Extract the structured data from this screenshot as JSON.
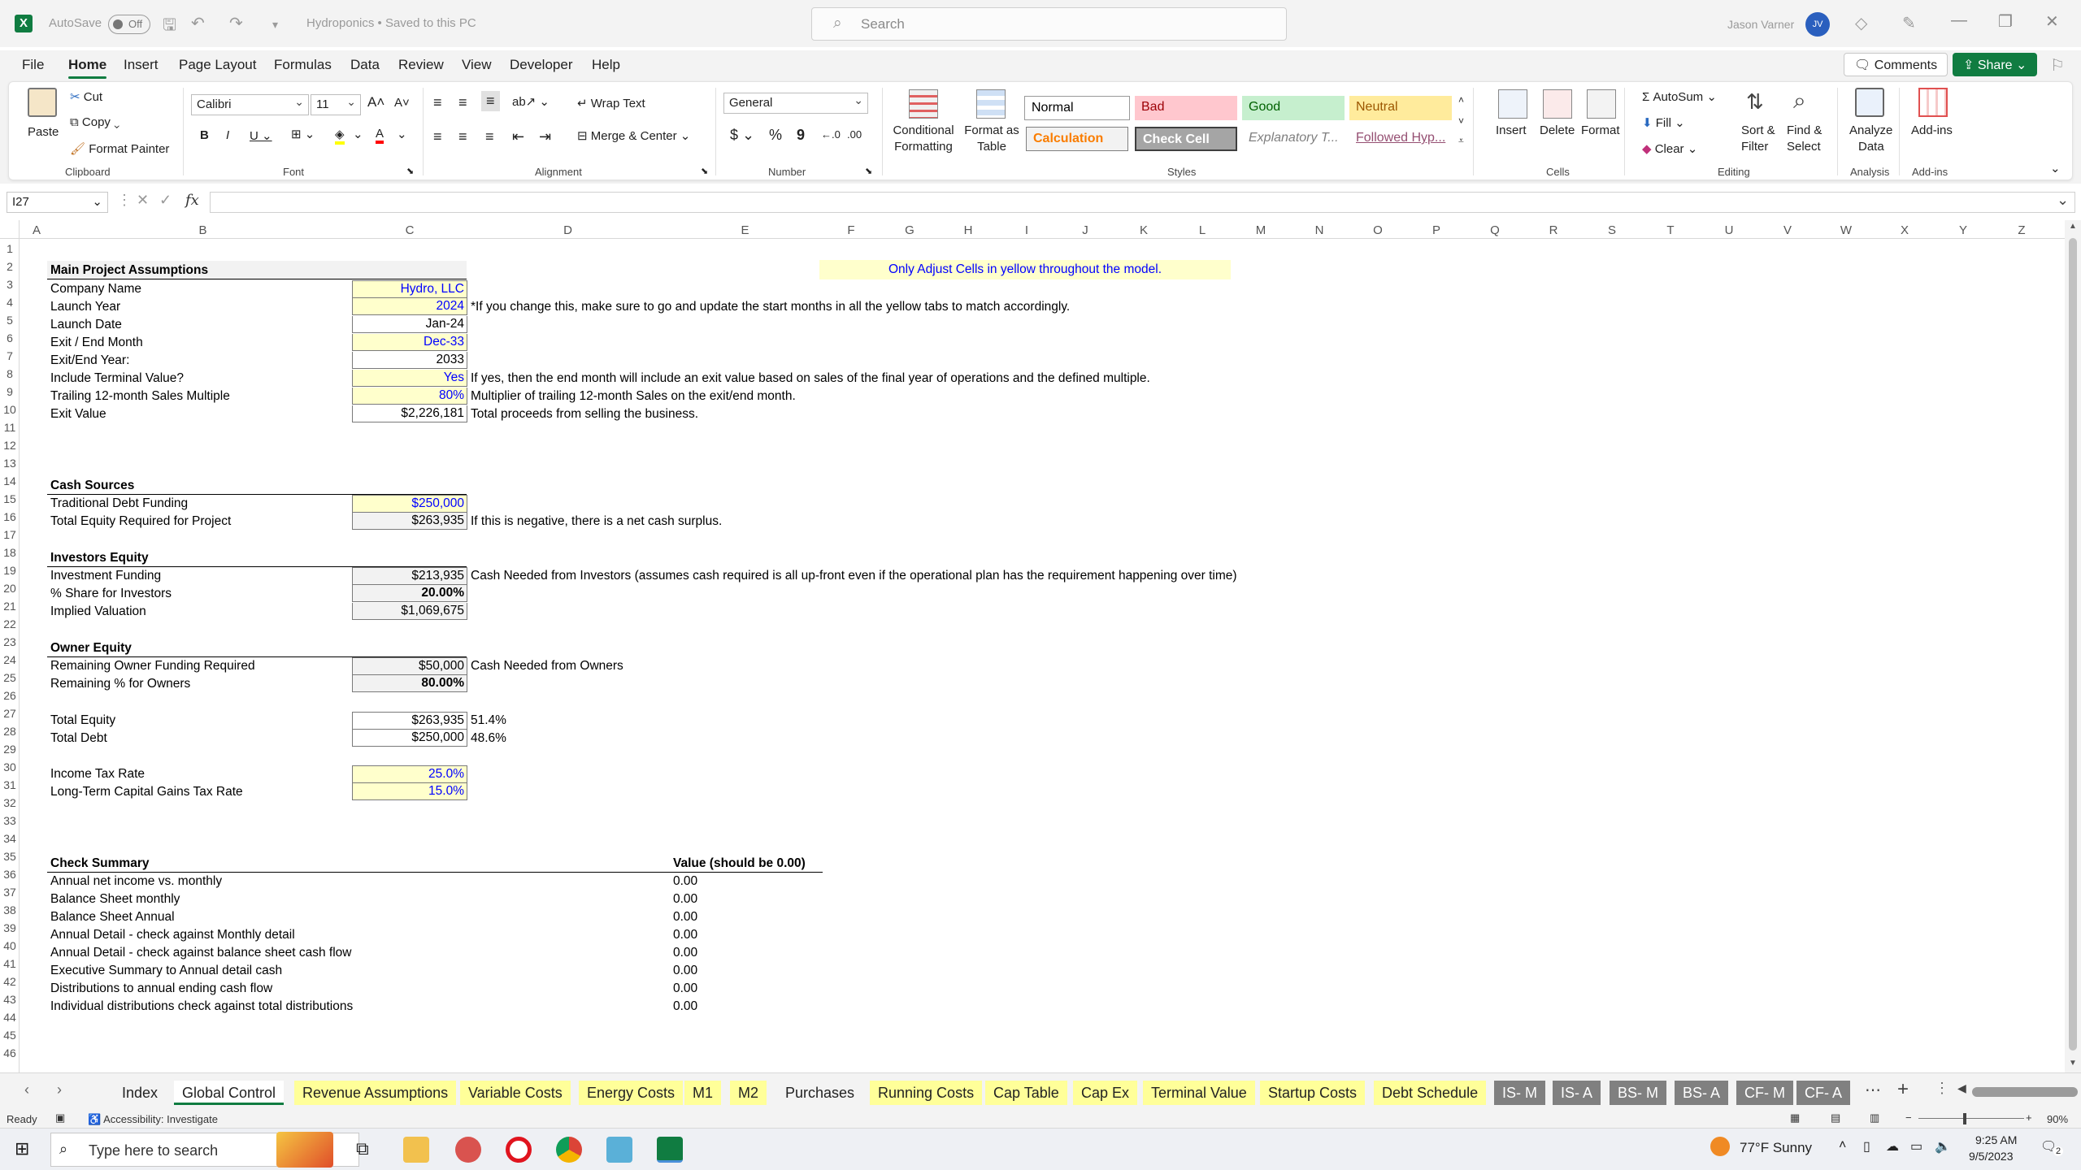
{
  "titlebar": {
    "autosave_label": "AutoSave",
    "autosave_state": "Off",
    "doc_title": "Hydroponics • Saved to this PC",
    "search_placeholder": "Search",
    "user_name": "Jason Varner",
    "user_initials": "JV"
  },
  "menu": {
    "tabs": [
      "File",
      "Home",
      "Insert",
      "Page Layout",
      "Formulas",
      "Data",
      "Review",
      "View",
      "Developer",
      "Help"
    ],
    "comments": "Comments",
    "share": "Share"
  },
  "ribbon": {
    "clipboard": {
      "paste": "Paste",
      "cut": "Cut",
      "copy": "Copy",
      "format_painter": "Format Painter",
      "group": "Clipboard"
    },
    "font": {
      "name": "Calibri",
      "size": "11",
      "group": "Font"
    },
    "alignment": {
      "wrap": "Wrap Text",
      "merge": "Merge & Center",
      "group": "Alignment"
    },
    "number": {
      "format": "General",
      "group": "Number"
    },
    "styles": {
      "conditional": "Conditional",
      "conditional2": "Formatting",
      "format_as": "Format as",
      "format_as2": "Table",
      "normal": "Normal",
      "bad": "Bad",
      "good": "Good",
      "neutral": "Neutral",
      "calculation": "Calculation",
      "check_cell": "Check Cell",
      "explanatory": "Explanatory T...",
      "followed": "Followed Hyp...",
      "group": "Styles"
    },
    "cells": {
      "insert": "Insert",
      "delete": "Delete",
      "format": "Format",
      "group": "Cells"
    },
    "editing": {
      "autosum": "AutoSum",
      "fill": "Fill",
      "clear": "Clear",
      "sort": "Sort &",
      "sort2": "Filter",
      "find": "Find &",
      "find2": "Select",
      "group": "Editing"
    },
    "analysis": {
      "analyze": "Analyze",
      "analyze2": "Data",
      "group": "Analysis"
    },
    "addins": {
      "label": "Add-ins",
      "group": "Add-ins"
    }
  },
  "formula_bar": {
    "name_box": "I27",
    "formula": ""
  },
  "columns": [
    "A",
    "B",
    "C",
    "D",
    "E",
    "F",
    "G",
    "H",
    "I",
    "J",
    "K",
    "L",
    "M",
    "N",
    "O",
    "P",
    "Q",
    "R",
    "S",
    "T",
    "U",
    "V",
    "W",
    "X",
    "Y",
    "Z"
  ],
  "rows": [
    "1",
    "2",
    "3",
    "4",
    "5",
    "6",
    "7",
    "8",
    "9",
    "10",
    "11",
    "12",
    "13",
    "14",
    "15",
    "16",
    "17",
    "18",
    "19",
    "20",
    "21",
    "22",
    "23",
    "24",
    "25",
    "26",
    "27",
    "28",
    "29",
    "30",
    "31",
    "32",
    "33",
    "34",
    "35",
    "36",
    "37",
    "38",
    "39",
    "40",
    "41",
    "42",
    "43",
    "44",
    "45",
    "46"
  ],
  "sheet": {
    "note": "Only Adjust Cells in yellow throughout the model.",
    "main_header": "Main Project Assumptions",
    "company_label": "Company Name",
    "company_value": "Hydro, LLC",
    "launch_year_label": "Launch Year",
    "launch_year_value": "2024",
    "launch_year_note": "*If you change this, make sure to go and update the start months in all the yellow tabs to match accordingly.",
    "launch_date_label": "Launch Date",
    "launch_date_value": "Jan-24",
    "exit_month_label": "Exit / End Month",
    "exit_month_value": "Dec-33",
    "exit_year_label": "Exit/End Year:",
    "exit_year_value": "2033",
    "terminal_label": "Include Terminal Value?",
    "terminal_value": "Yes",
    "terminal_note": "If yes, then the end month will include an exit value based on sales of the final year of operations and the defined multiple.",
    "multiple_label": "Trailing 12-month Sales Multiple",
    "multiple_value": "80%",
    "multiple_note": "Multiplier of trailing 12-month Sales on the exit/end month.",
    "exit_value_label": "Exit Value",
    "exit_value_value": "$2,226,181",
    "exit_value_note": "Total proceeds from selling the business.",
    "cash_header": "Cash Sources",
    "debt_label": "Traditional Debt Funding",
    "debt_value": "$250,000",
    "equity_req_label": "Total Equity Required for Project",
    "equity_req_value": "$263,935",
    "equity_req_note": "If this is negative, there is a net cash surplus.",
    "investors_header": "Investors Equity",
    "inv_funding_label": "Investment Funding",
    "inv_funding_value": "$213,935",
    "inv_funding_note": "Cash Needed from Investors (assumes cash required is all up-front even if the operational plan has the requirement happening over time)",
    "share_label": "% Share for Investors",
    "share_value": "20.00%",
    "valuation_label": "Implied Valuation",
    "valuation_value": "$1,069,675",
    "owner_header": "Owner Equity",
    "owner_funding_label": "Remaining Owner Funding Required",
    "owner_funding_value": "$50,000",
    "owner_funding_note": "Cash Needed from Owners",
    "owner_pct_label": "Remaining % for Owners",
    "owner_pct_value": "80.00%",
    "total_equity_label": "Total Equity",
    "total_equity_value": "$263,935",
    "total_equity_pct": "51.4%",
    "total_debt_label": "Total Debt",
    "total_debt_value": "$250,000",
    "total_debt_pct": "48.6%",
    "income_tax_label": "Income Tax Rate",
    "income_tax_value": "25.0%",
    "cap_gains_label": "Long-Term Capital Gains Tax Rate",
    "cap_gains_value": "15.0%",
    "check_header": "Check Summary",
    "check_value_header": "Value (should be 0.00)",
    "checks": [
      {
        "label": "Annual net income vs. monthly",
        "value": "0.00"
      },
      {
        "label": "Balance Sheet monthly",
        "value": "0.00"
      },
      {
        "label": "Balance Sheet Annual",
        "value": "0.00"
      },
      {
        "label": "Annual Detail - check against Monthly detail",
        "value": "0.00"
      },
      {
        "label": "Annual Detail - check against balance sheet cash flow",
        "value": "0.00"
      },
      {
        "label": "Executive Summary to Annual detail cash",
        "value": "0.00"
      },
      {
        "label": "Distributions to annual ending cash flow",
        "value": "0.00"
      },
      {
        "label": "Individual distributions check against total distributions",
        "value": "0.00"
      }
    ]
  },
  "sheet_tabs": [
    "Index",
    "Global Control",
    "Revenue Assumptions",
    "Variable Costs",
    "Energy Costs",
    "M1",
    "M2",
    "Purchases",
    "Running Costs",
    "Cap Table",
    "Cap Ex",
    "Terminal Value",
    "Startup Costs",
    "Debt Schedule",
    "IS- M",
    "IS- A",
    "BS- M",
    "BS- A",
    "CF- M",
    "CF- A"
  ],
  "status": {
    "ready": "Ready",
    "accessibility": "Accessibility: Investigate",
    "zoom": "90%"
  },
  "taskbar": {
    "search": "Type here to search",
    "weather": "77°F  Sunny",
    "time": "9:25 AM",
    "date": "9/5/2023",
    "notif": "2"
  },
  "colors": {
    "excel_green": "#107c41",
    "input_yellow": "#ffffcc",
    "input_blue": "#0000ff",
    "calc_gray": "#f2f2f2"
  }
}
